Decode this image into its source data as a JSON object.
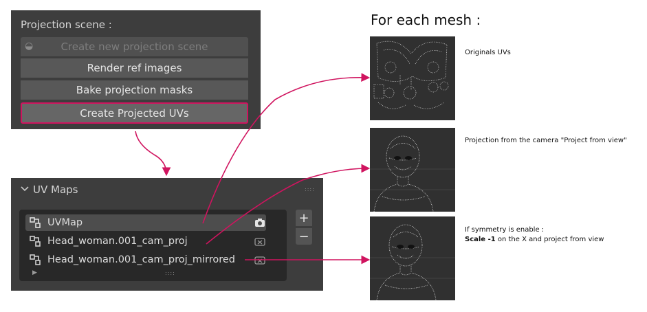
{
  "projection_panel": {
    "title": "Projection scene :",
    "buttons": {
      "create_scene": "Create new projection scene",
      "render_ref": "Render ref images",
      "bake_masks": "Bake projection masks",
      "create_uvs": "Create Projected UVs"
    }
  },
  "uv_panel": {
    "title": "UV Maps",
    "items": [
      {
        "label": "UVMap",
        "active": true
      },
      {
        "label": "Head_woman.001_cam_proj",
        "active": false
      },
      {
        "label": "Head_woman.001_cam_proj_mirrored",
        "active": false
      }
    ],
    "add_label": "+",
    "remove_label": "−"
  },
  "annotations": {
    "heading": "For each mesh :",
    "captions": [
      {
        "line1": "Originals UVs"
      },
      {
        "line1": "Projection from the camera \"Project from view\""
      },
      {
        "line1": "If symmetry is enable :",
        "bold": "Scale -1",
        "rest": " on the X and project from view"
      }
    ]
  },
  "colors": {
    "panel": "#3d3d3d",
    "highlight": "#d0145f",
    "arrow": "#d0145f"
  }
}
